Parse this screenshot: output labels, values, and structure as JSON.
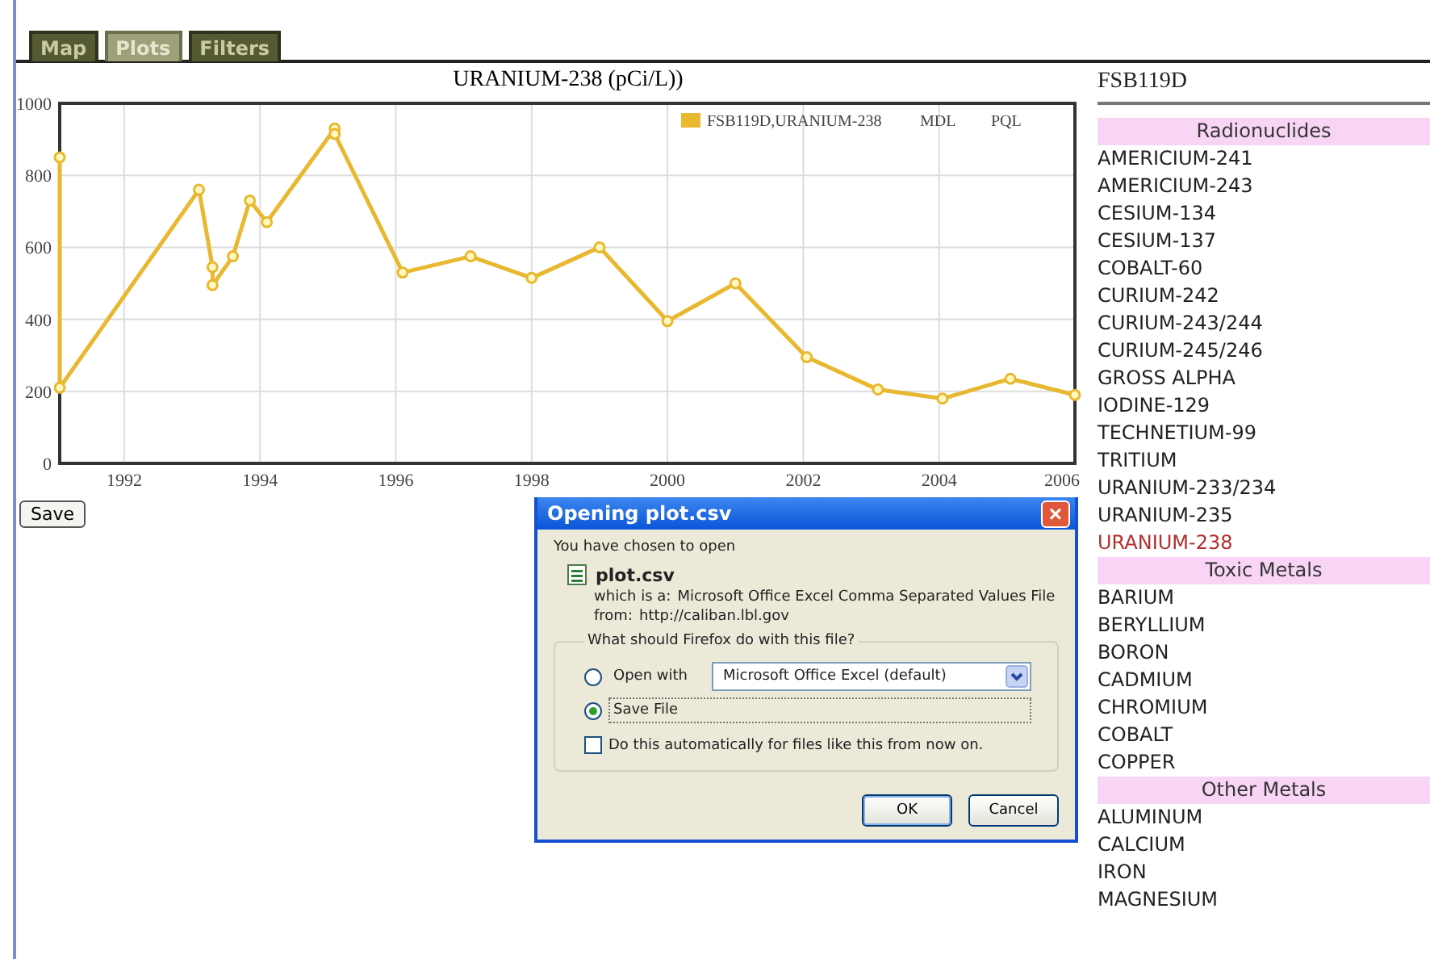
{
  "tabs": [
    {
      "label": "Map",
      "selected": false
    },
    {
      "label": "Plots",
      "selected": true
    },
    {
      "label": "Filters",
      "selected": false
    }
  ],
  "plot": {
    "legend_extra": [
      "MDL",
      "PQL"
    ],
    "chart_data": {
      "type": "line",
      "title": "URANIUM-238 (pCi/L))",
      "x": [
        1991.05,
        1991.05,
        1993.1,
        1993.3,
        1993.3,
        1993.6,
        1993.85,
        1994.1,
        1995.1,
        1995.1,
        1996.1,
        1997.1,
        1998.0,
        1999.0,
        2000.0,
        2001.0,
        2002.05,
        2003.1,
        2004.05,
        2005.05,
        2006.0
      ],
      "series": [
        {
          "name": "FSB119D,URANIUM-238",
          "color": "#e8b830",
          "marker": "circle",
          "values": [
            850,
            210,
            760,
            545,
            495,
            575,
            730,
            670,
            930,
            915,
            530,
            575,
            515,
            600,
            395,
            500,
            295,
            205,
            180,
            235,
            190
          ]
        }
      ],
      "xlim": [
        1991.05,
        2006
      ],
      "ylim": [
        0,
        1000
      ],
      "xticks": [
        1992,
        1994,
        1996,
        1998,
        2000,
        2002,
        2004,
        2006
      ],
      "yticks": [
        0,
        200,
        400,
        600,
        800,
        1000
      ],
      "grid": true
    },
    "save_button": "Save"
  },
  "sidebar": {
    "title": "FSB119D",
    "groups": [
      {
        "header": "Radionuclides",
        "items": [
          {
            "label": "AMERICIUM-241",
            "selected": false
          },
          {
            "label": "AMERICIUM-243",
            "selected": false
          },
          {
            "label": "CESIUM-134",
            "selected": false
          },
          {
            "label": "CESIUM-137",
            "selected": false
          },
          {
            "label": "COBALT-60",
            "selected": false
          },
          {
            "label": "CURIUM-242",
            "selected": false
          },
          {
            "label": "CURIUM-243/244",
            "selected": false
          },
          {
            "label": "CURIUM-245/246",
            "selected": false
          },
          {
            "label": "GROSS ALPHA",
            "selected": false
          },
          {
            "label": "IODINE-129",
            "selected": false
          },
          {
            "label": "TECHNETIUM-99",
            "selected": false
          },
          {
            "label": "TRITIUM",
            "selected": false
          },
          {
            "label": "URANIUM-233/234",
            "selected": false
          },
          {
            "label": "URANIUM-235",
            "selected": false
          },
          {
            "label": "URANIUM-238",
            "selected": true
          }
        ]
      },
      {
        "header": "Toxic Metals",
        "items": [
          {
            "label": "BARIUM",
            "selected": false
          },
          {
            "label": "BERYLLIUM",
            "selected": false
          },
          {
            "label": "BORON",
            "selected": false
          },
          {
            "label": "CADMIUM",
            "selected": false
          },
          {
            "label": "CHROMIUM",
            "selected": false
          },
          {
            "label": "COBALT",
            "selected": false
          },
          {
            "label": "COPPER",
            "selected": false
          }
        ]
      },
      {
        "header": "Other Metals",
        "items": [
          {
            "label": "ALUMINUM",
            "selected": false
          },
          {
            "label": "CALCIUM",
            "selected": false
          },
          {
            "label": "IRON",
            "selected": false
          },
          {
            "label": "MAGNESIUM",
            "selected": false
          }
        ]
      }
    ]
  },
  "dialog": {
    "title": "Opening plot.csv",
    "close": "×",
    "intro": "You have chosen to open",
    "file_name": "plot.csv",
    "type_label": "which is a:",
    "type_value": "Microsoft Office Excel Comma Separated Values File",
    "from_label": "from:",
    "from_value": "http://caliban.lbl.gov",
    "question": "What should Firefox do with this file?",
    "options": [
      {
        "label": "Open with",
        "selected": false,
        "dropdown": "Microsoft Office Excel (default)"
      },
      {
        "label": "Save File",
        "selected": true
      }
    ],
    "auto": {
      "label": "Do this automatically for files like this from now on.",
      "checked": false
    },
    "buttons": [
      "OK",
      "Cancel"
    ]
  }
}
